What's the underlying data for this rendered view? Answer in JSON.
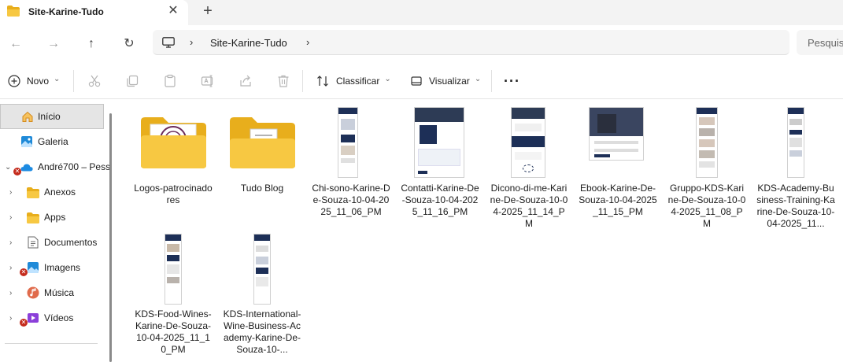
{
  "tab": {
    "title": "Site-Karine-Tudo",
    "close": "✕",
    "new": "+"
  },
  "nav": {
    "back": "←",
    "forward": "→",
    "up": "↑",
    "refresh": "↻"
  },
  "address": {
    "crumb": "Site-Karine-Tudo",
    "sep": "›"
  },
  "search": {
    "placeholder": "Pesquis"
  },
  "toolbar": {
    "new_label": "Novo",
    "sort_label": "Classificar",
    "view_label": "Visualizar",
    "more": "···",
    "dropdown": "⌄"
  },
  "sidebar": {
    "items": [
      {
        "label": "Início",
        "icon": "home-icon",
        "selected": true
      },
      {
        "label": "Galeria",
        "icon": "gallery-icon"
      },
      {
        "label": "André700 – Pess",
        "icon": "onedrive-icon",
        "error": true
      },
      {
        "label": "Anexos",
        "icon": "folder-icon"
      },
      {
        "label": "Apps",
        "icon": "folder-icon"
      },
      {
        "label": "Documentos",
        "icon": "documents-icon"
      },
      {
        "label": "Imagens",
        "icon": "pictures-icon",
        "error": true
      },
      {
        "label": "Música",
        "icon": "music-icon"
      },
      {
        "label": "Vídeos",
        "icon": "videos-icon",
        "error": true
      }
    ]
  },
  "files": [
    {
      "name": "Logos-patrocinadores",
      "kind": "folder"
    },
    {
      "name": "Tudo Blog",
      "kind": "folder"
    },
    {
      "name": "Chi-sono-Karine-De-Souza-10-04-2025_11_06_PM",
      "kind": "image"
    },
    {
      "name": "Contatti-Karine-De-Souza-10-04-2025_11_16_PM",
      "kind": "image"
    },
    {
      "name": "Dicono-di-me-Karine-De-Souza-10-04-2025_11_14_PM",
      "kind": "image"
    },
    {
      "name": "Ebook-Karine-De-Souza-10-04-2025_11_15_PM",
      "kind": "image"
    },
    {
      "name": "Gruppo-KDS-Karine-De-Souza-10-04-2025_11_08_PM",
      "kind": "image"
    },
    {
      "name": "KDS-Academy-Business-Training-Karine-De-Souza-10-04-2025_11...",
      "kind": "image"
    },
    {
      "name": "KDS-Food-Wines-Karine-De-Souza-10-04-2025_11_10_PM",
      "kind": "image"
    },
    {
      "name": "KDS-International-Wine-Business-Academy-Karine-De-Souza-10-...",
      "kind": "image"
    }
  ],
  "colors": {
    "folder": "#f7c842",
    "folder_dark": "#e8ae1c",
    "accent": "#0067c0",
    "error": "#c42b1c"
  }
}
